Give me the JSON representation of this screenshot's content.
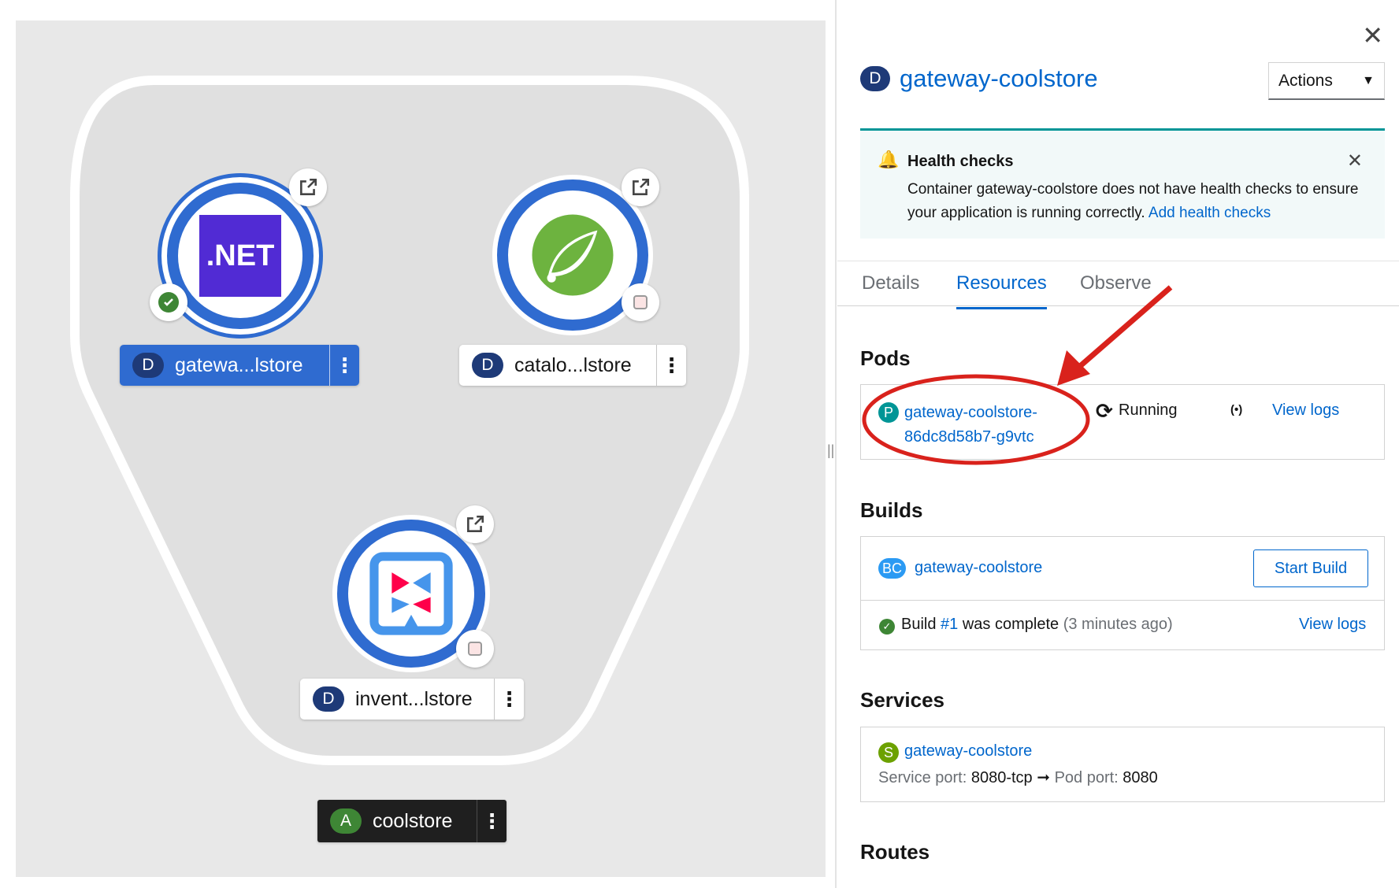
{
  "topology": {
    "nodes": [
      {
        "id": "gateway",
        "icon": "dotnet-icon",
        "logo_text": ".NET",
        "kind": "D",
        "label": "gatewa...lstore",
        "selected": true,
        "status": "success"
      },
      {
        "id": "catalog",
        "icon": "spring-leaf-icon",
        "kind": "D",
        "label": "catalo...lstore",
        "selected": false
      },
      {
        "id": "inventory",
        "icon": "quarkus-icon",
        "kind": "D",
        "label": "invent...lstore",
        "selected": false
      }
    ],
    "application": {
      "kind": "A",
      "label": "coolstore"
    }
  },
  "panel": {
    "title_badge": "D",
    "title": "gateway-coolstore",
    "actions_label": "Actions",
    "alert": {
      "title": "Health checks",
      "body": "Container gateway-coolstore does not have health checks to ensure your application is running correctly.",
      "link": "Add health checks"
    },
    "tabs": [
      "Details",
      "Resources",
      "Observe"
    ],
    "active_tab": "Resources",
    "pods": {
      "heading": "Pods",
      "badge": "P",
      "name_line1": "gateway-coolstore-",
      "name_line2": "86dc8d58b7-g9vtc",
      "status": "Running",
      "logs_link": "View logs"
    },
    "builds": {
      "heading": "Builds",
      "badge": "BC",
      "name": "gateway-coolstore",
      "start_button": "Start Build",
      "build_prefix": "Build",
      "build_number": "#1",
      "build_text": "was complete",
      "build_time": "(3 minutes ago)",
      "logs_link": "View logs"
    },
    "services": {
      "heading": "Services",
      "badge": "S",
      "name": "gateway-coolstore",
      "service_port_label": "Service port:",
      "service_port": "8080-tcp",
      "pod_port_label": "Pod port:",
      "pod_port": "8080"
    },
    "routes": {
      "heading": "Routes"
    }
  },
  "colors": {
    "accent": "#0066cc",
    "node_ring": "#2f6bd0",
    "deployment_badge": "#1e3a78",
    "application_badge": "#3e8635",
    "annotation": "#d9221c"
  }
}
